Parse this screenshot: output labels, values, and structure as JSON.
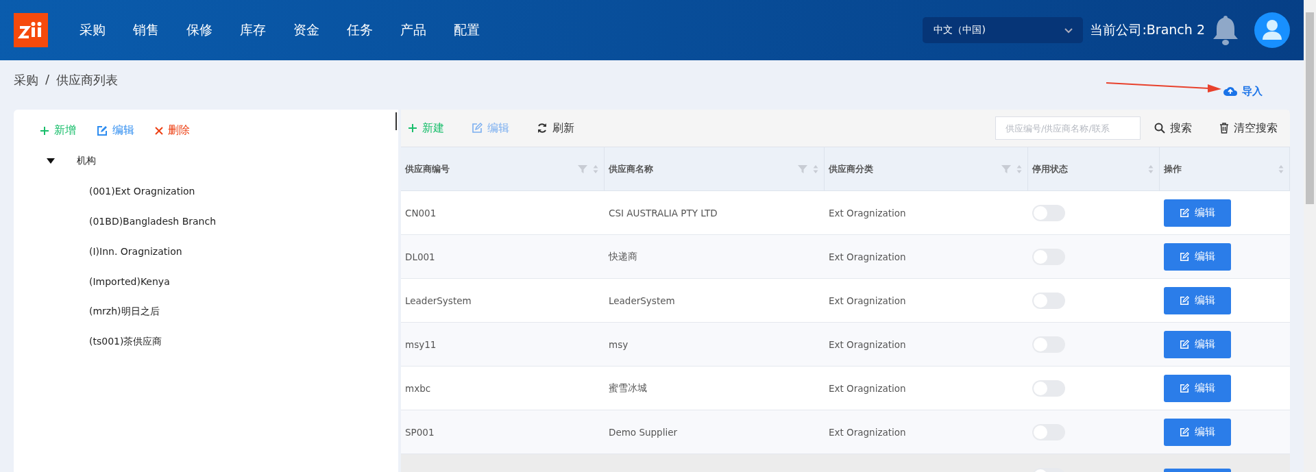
{
  "header": {
    "nav": [
      "采购",
      "销售",
      "保修",
      "库存",
      "资金",
      "任务",
      "产品",
      "配置"
    ],
    "language": "中文（中国)",
    "company": "当前公司:Branch 2"
  },
  "breadcrumb": [
    "采购",
    "/",
    "供应商列表"
  ],
  "import_link": "导入",
  "tree_toolbar": [
    {
      "kind": "add",
      "label": "新增"
    },
    {
      "kind": "edit",
      "label": "编辑"
    },
    {
      "kind": "delete",
      "label": "删除"
    }
  ],
  "tree": {
    "label": "机构",
    "expanded": true,
    "children": [
      {
        "label": "(001)Ext Oragnization"
      },
      {
        "label": "(01BD)Bangladesh Branch"
      },
      {
        "label": "(I)Inn. Oragnization"
      },
      {
        "label": "(Imported)Kenya"
      },
      {
        "label": "(mrzh)明日之后"
      },
      {
        "label": "(ts001)茶供应商"
      }
    ]
  },
  "table_toolbar": {
    "buttons": [
      {
        "kind": "add",
        "label": "新建"
      },
      {
        "kind": "edit",
        "label": "编辑"
      },
      {
        "kind": "refresh",
        "label": "刷新"
      }
    ],
    "search": {
      "placeholder": "供应编号/供应商名称/联系"
    },
    "search_button": "搜索",
    "clear_button": "清空搜索"
  },
  "table": {
    "columns": [
      {
        "label": "供应商编号",
        "filter": true
      },
      {
        "label": "供应商名称",
        "filter": true
      },
      {
        "label": "供应商分类",
        "filter": true
      },
      {
        "label": "停用状态",
        "filter": false
      },
      {
        "label": "操作",
        "filter": false
      }
    ],
    "rows": [
      {
        "code": "CN001",
        "name": "CSI AUSTRALIA PTY LTD",
        "category": "Ext Oragnization",
        "disabled": false,
        "action": "编辑"
      },
      {
        "code": "DL001",
        "name": "快递商",
        "category": "Ext Oragnization",
        "disabled": false,
        "action": "编辑"
      },
      {
        "code": "LeaderSystem",
        "name": "LeaderSystem",
        "category": "Ext Oragnization",
        "disabled": false,
        "action": "编辑"
      },
      {
        "code": "msy11",
        "name": "msy",
        "category": "Ext Oragnization",
        "disabled": false,
        "action": "编辑"
      },
      {
        "code": "mxbc",
        "name": "蜜雪冰城",
        "category": "Ext Oragnization",
        "disabled": false,
        "action": "编辑"
      },
      {
        "code": "SP001",
        "name": "Demo Supplier",
        "category": "Ext Oragnization",
        "disabled": false,
        "action": "编辑"
      }
    ],
    "cut_row": {
      "disabled": false
    }
  }
}
